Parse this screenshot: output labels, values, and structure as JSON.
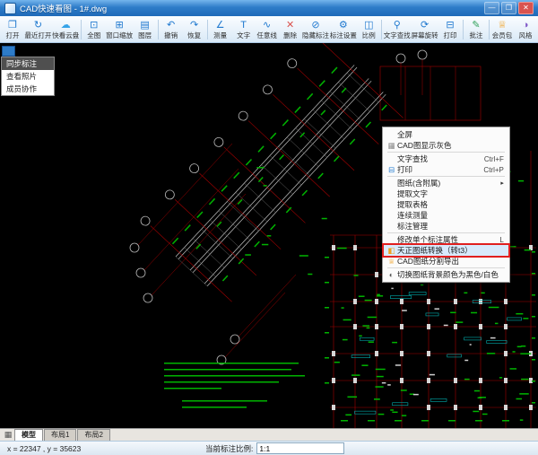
{
  "window": {
    "title": "CAD快速看图 - 1#.dwg",
    "controls": {
      "minimize": "—",
      "maximize": "❐",
      "close": "✕"
    }
  },
  "toolbar": {
    "items": [
      {
        "label": "打开",
        "icon": "open-file-icon"
      },
      {
        "label": "最近打开",
        "icon": "recent-files-icon"
      },
      {
        "label": "快看云盘",
        "icon": "cloud-drive-icon",
        "sep_after": true
      },
      {
        "label": "全图",
        "icon": "fit-view-icon"
      },
      {
        "label": "窗口缩放",
        "icon": "window-zoom-icon"
      },
      {
        "label": "图层",
        "icon": "layers-icon",
        "sep_after": true
      },
      {
        "label": "撤销",
        "icon": "undo-icon"
      },
      {
        "label": "恢复",
        "icon": "redo-icon",
        "sep_after": true
      },
      {
        "label": "测量",
        "icon": "measure-icon"
      },
      {
        "label": "文字",
        "icon": "text-icon"
      },
      {
        "label": "任意线",
        "icon": "freehand-line-icon"
      },
      {
        "label": "删除",
        "icon": "delete-icon"
      },
      {
        "label": "隐藏标注",
        "icon": "hide-markup-icon"
      },
      {
        "label": "标注设置",
        "icon": "markup-settings-icon"
      },
      {
        "label": "比例",
        "icon": "scale-icon",
        "sep_after": true
      },
      {
        "label": "文字查找",
        "icon": "text-search-icon"
      },
      {
        "label": "屏幕旋转",
        "icon": "screen-rotate-icon"
      },
      {
        "label": "打印",
        "icon": "print-icon",
        "sep_after": true
      },
      {
        "label": "批注",
        "icon": "comment-icon",
        "sep_after": true
      },
      {
        "label": "会员包",
        "icon": "vip-package-icon"
      },
      {
        "label": "风格",
        "icon": "style-icon"
      }
    ]
  },
  "left_menu": {
    "items": [
      {
        "label": "同步标注",
        "active": true
      },
      {
        "label": "查看照片"
      },
      {
        "label": "成员协作"
      }
    ]
  },
  "context_menu": {
    "items": [
      {
        "label": "全屏"
      },
      {
        "label": "CAD图显示灰色",
        "icon": "grayscale-icon"
      },
      {
        "separator": true
      },
      {
        "label": "文字查找",
        "shortcut": "Ctrl+F"
      },
      {
        "label": "打印",
        "shortcut": "Ctrl+P",
        "icon": "print-icon"
      },
      {
        "separator": true
      },
      {
        "label": "图纸(含附属)",
        "submenu": true
      },
      {
        "label": "提取文字"
      },
      {
        "label": "提取表格"
      },
      {
        "label": "连续测量"
      },
      {
        "label": "标注管理"
      },
      {
        "separator": true
      },
      {
        "label": "修改单个标注属性",
        "shortcut": "L"
      },
      {
        "label": "天正图纸转换（转t3）",
        "icon": "tianzheng-convert-icon",
        "highlighted": true
      },
      {
        "label": "CAD图纸分割导出",
        "icon": "vip-feature-icon"
      },
      {
        "separator": true
      },
      {
        "label": "切换图纸背景颜色为黑色/白色",
        "icon": "background-toggle-icon"
      }
    ]
  },
  "sheet_tabs": {
    "nav_icon": "sheet-grid-icon",
    "tabs": [
      {
        "label": "模型",
        "active": true
      },
      {
        "label": "布局1"
      },
      {
        "label": "布局2"
      }
    ]
  },
  "status_bar": {
    "coordinates": "x = 22347 , y = 35623",
    "scale_label": "当前标注比例:",
    "scale_value": "1:1"
  },
  "colors": {
    "titlebar_blue": "#2e7cc9",
    "canvas_background": "#000000",
    "cad_line_red": "#a50000",
    "cad_text_green": "#00b400",
    "annotation_highlight_red": "#e01f1f"
  }
}
